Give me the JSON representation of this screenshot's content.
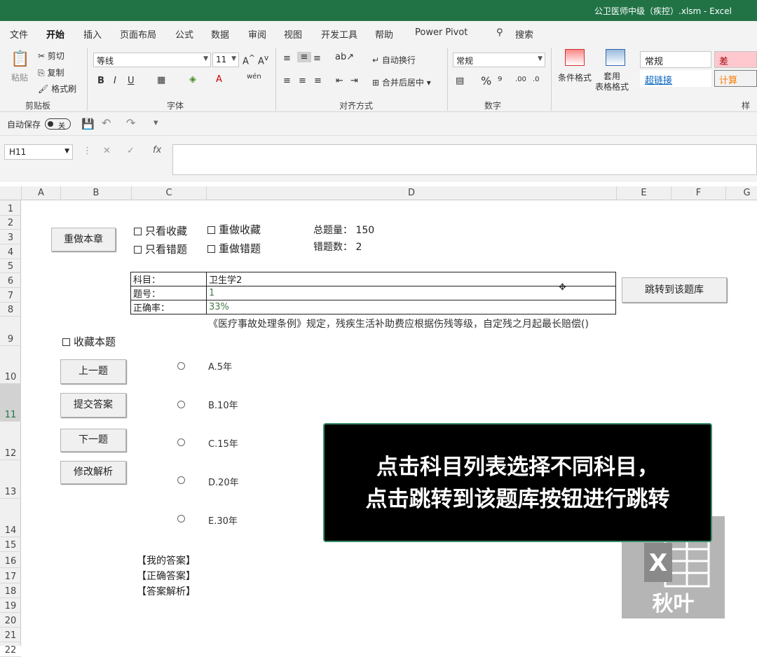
{
  "window": {
    "title": "公卫医师中级（疾控）.xlsm  -  Excel"
  },
  "ribbon_tabs": [
    "文件",
    "开始",
    "插入",
    "页面布局",
    "公式",
    "数据",
    "审阅",
    "视图",
    "开发工具",
    "帮助",
    "Power Pivot",
    "搜索"
  ],
  "clipboard": {
    "paste": "粘贴",
    "cut": "剪切",
    "copy": "复制",
    "format_painter": "格式刷",
    "group": "剪贴板"
  },
  "font": {
    "name": "等线",
    "size": "11",
    "bold": "B",
    "italic": "I",
    "underline": "U",
    "group": "字体"
  },
  "alignment": {
    "wrap": "自动换行",
    "merge": "合并后居中",
    "group": "对齐方式"
  },
  "number": {
    "format": "常规",
    "group": "数字"
  },
  "styles": {
    "conditional": "条件格式",
    "table_format": "套用\n表格格式",
    "normal": "常规",
    "bad": "差",
    "hyperlink": "超链接",
    "calc": "计算",
    "group": "样式"
  },
  "qat": {
    "autosave": "自动保存",
    "autosave_state": "关"
  },
  "name_box": "H11",
  "columns": [
    "A",
    "B",
    "C",
    "D",
    "E",
    "F",
    "G"
  ],
  "rows": [
    "1",
    "2",
    "3",
    "4",
    "5",
    "6",
    "7",
    "8",
    "9",
    "10",
    "11",
    "12",
    "13",
    "14",
    "15",
    "16",
    "17",
    "18",
    "19",
    "20",
    "21",
    "22"
  ],
  "controls": {
    "redo_chapter": "重做本章",
    "only_favorites": "只看收藏",
    "only_wrong": "只看错题",
    "redo_favorites": "重做收藏",
    "redo_wrong": "重做错题",
    "total_label": "总题量：",
    "total_value": "150",
    "wrong_label": "错题数：",
    "wrong_value": "2",
    "jump_button": "跳转到该题库",
    "favorite_this": "收藏本题",
    "prev": "上一题",
    "submit": "提交答案",
    "next": "下一题",
    "edit_analysis": "修改解析"
  },
  "info_table": [
    {
      "label": "科目：",
      "value": "卫生学2"
    },
    {
      "label": "题号：",
      "value": "1"
    },
    {
      "label": "正确率：",
      "value": "33%"
    }
  ],
  "question": "《医疗事故处理条例》规定，残疾生活补助费应根据伤残等级，自定残之月起最长赔偿()",
  "options": [
    "A.5年",
    "B.10年",
    "C.15年",
    "D.20年",
    "E.30年"
  ],
  "answers": {
    "mine": "【我的答案】",
    "correct": "【正确答案】",
    "analysis": "【答案解析】"
  },
  "overlay": {
    "line1": "点击科目列表选择不同科目，",
    "line2": "点击跳转到该题库按钮进行跳转"
  },
  "watermark": {
    "text": "秋叶"
  }
}
